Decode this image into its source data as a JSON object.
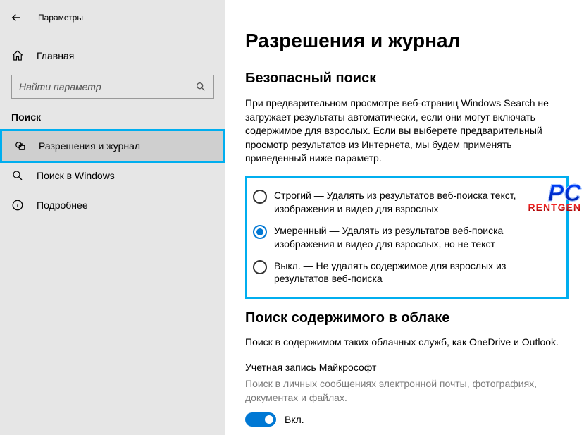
{
  "titlebar": {
    "app_title": "Параметры"
  },
  "sidebar": {
    "home_label": "Главная",
    "search_placeholder": "Найти параметр",
    "section": "Поиск",
    "items": [
      {
        "label": "Разрешения и журнал"
      },
      {
        "label": "Поиск в Windows"
      },
      {
        "label": "Подробнее"
      }
    ]
  },
  "main": {
    "title": "Разрешения и журнал",
    "safesearch": {
      "title": "Безопасный поиск",
      "desc": "При предварительном просмотре веб-страниц Windows Search не загружает результаты автоматически, если они могут включать содержимое для взрослых. Если вы выберете предварительный просмотр результатов из Интернета, мы будем применять приведенный ниже параметр.",
      "options": [
        "Строгий — Удалять из результатов веб-поиска текст, изображения и видео для взрослых",
        "Умеренный — Удалять из результатов веб-поиска изображения и видео для взрослых, но не текст",
        "Выкл. — Не удалять содержимое для взрослых из результатов веб-поиска"
      ],
      "selected": 1
    },
    "cloud": {
      "title": "Поиск содержимого в облаке",
      "desc": "Поиск в содержимом таких облачных служб, как OneDrive и Outlook.",
      "ms_label": "Учетная запись Майкрософт",
      "ms_note": "Поиск в личных сообщениях электронной почты, фотографиях, документах и файлах.",
      "toggle_label": "Вкл."
    }
  },
  "watermark": {
    "big": "PC",
    "small": "RENTGEN"
  }
}
